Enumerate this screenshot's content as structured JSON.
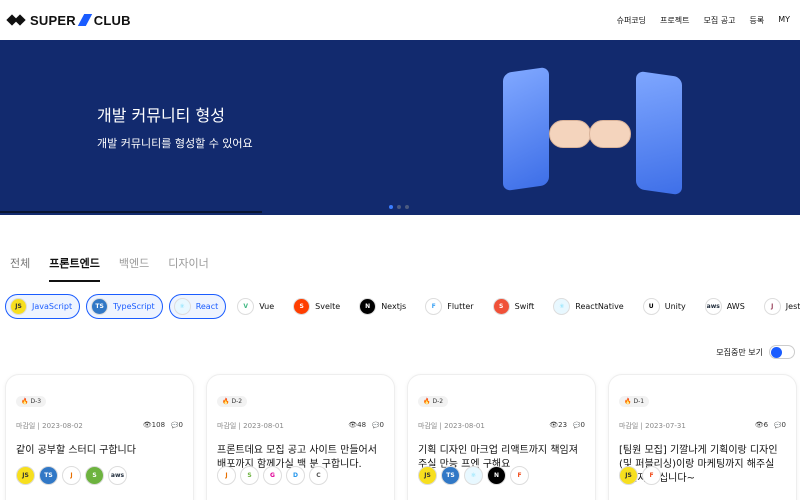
{
  "brand": {
    "name_left": "SUPER",
    "name_right": "CLUB"
  },
  "nav": [
    "슈퍼코딩",
    "프로젝트",
    "모집 공고",
    "등록",
    "MY"
  ],
  "hero": {
    "title": "개발 커뮤니티 형성",
    "subtitle": "개발 커뮤니티를 형성할 수 있어요"
  },
  "tabs": [
    "전체",
    "프론트엔드",
    "백엔드",
    "디자이너"
  ],
  "stacks": [
    {
      "label": "JavaScript",
      "abbr": "JS",
      "color": "#f7df1e",
      "fg": "#333",
      "selected": true
    },
    {
      "label": "TypeScript",
      "abbr": "TS",
      "color": "#3178c6",
      "fg": "#fff",
      "selected": true
    },
    {
      "label": "React",
      "abbr": "⚛",
      "color": "#e8f8ff",
      "fg": "#61dafb",
      "selected": true
    },
    {
      "label": "Vue",
      "abbr": "V",
      "color": "#fff",
      "fg": "#41b883",
      "selected": false
    },
    {
      "label": "Svelte",
      "abbr": "S",
      "color": "#ff3e00",
      "fg": "#fff",
      "selected": false
    },
    {
      "label": "Nextjs",
      "abbr": "N",
      "color": "#000",
      "fg": "#fff",
      "selected": false
    },
    {
      "label": "Flutter",
      "abbr": "F",
      "color": "#fff",
      "fg": "#42a5f5",
      "selected": false
    },
    {
      "label": "Swift",
      "abbr": "S",
      "color": "#f05138",
      "fg": "#fff",
      "selected": false
    },
    {
      "label": "ReactNative",
      "abbr": "⚛",
      "color": "#e8f8ff",
      "fg": "#61dafb",
      "selected": false
    },
    {
      "label": "Unity",
      "abbr": "U",
      "color": "#fff",
      "fg": "#000",
      "selected": false
    },
    {
      "label": "AWS",
      "abbr": "aws",
      "color": "#fff",
      "fg": "#232f3e",
      "selected": false
    },
    {
      "label": "Jest",
      "abbr": "J",
      "color": "#fff",
      "fg": "#99425b",
      "selected": false
    }
  ],
  "toggle_label": "모집중만 보기",
  "cards": [
    {
      "dday": "D-3",
      "deadline": "마감일 | 2023-08-02",
      "views": "108",
      "comments": "0",
      "title": "같이 공부할 스터디 구합니다",
      "icons": [
        {
          "abbr": "JS",
          "color": "#f7df1e",
          "fg": "#333",
          "name": "javascript-icon"
        },
        {
          "abbr": "TS",
          "color": "#3178c6",
          "fg": "#fff",
          "name": "typescript-icon"
        },
        {
          "abbr": "J",
          "color": "#fff",
          "fg": "#e76f00",
          "name": "java-icon"
        },
        {
          "abbr": "S",
          "color": "#6db33f",
          "fg": "#fff",
          "name": "spring-icon"
        },
        {
          "abbr": "aws",
          "color": "#fff",
          "fg": "#232f3e",
          "name": "aws-icon"
        }
      ]
    },
    {
      "dday": "D-2",
      "deadline": "마감일 | 2023-08-01",
      "views": "48",
      "comments": "0",
      "title": "프론트데요 모집 공고 사이트 만들어서 배포까지 함께가실 백 분 구합니다.",
      "icons": [
        {
          "abbr": "J",
          "color": "#fff",
          "fg": "#e76f00",
          "name": "java-icon"
        },
        {
          "abbr": "S",
          "color": "#fff",
          "fg": "#6db33f",
          "name": "spring-icon"
        },
        {
          "abbr": "G",
          "color": "#fff",
          "fg": "#e10098",
          "name": "graphql-icon"
        },
        {
          "abbr": "D",
          "color": "#fff",
          "fg": "#2496ed",
          "name": "docker-icon"
        },
        {
          "abbr": "C",
          "color": "#fff",
          "fg": "#555",
          "name": "c-icon"
        }
      ]
    },
    {
      "dday": "D-2",
      "deadline": "마감일 | 2023-08-01",
      "views": "23",
      "comments": "0",
      "title": "기획 디자인 마크업 리액트까지 책임져주실 만능 프엔 구해요",
      "icons": [
        {
          "abbr": "JS",
          "color": "#f7df1e",
          "fg": "#333",
          "name": "javascript-icon"
        },
        {
          "abbr": "TS",
          "color": "#3178c6",
          "fg": "#fff",
          "name": "typescript-icon"
        },
        {
          "abbr": "⚛",
          "color": "#e8f8ff",
          "fg": "#61dafb",
          "name": "react-icon"
        },
        {
          "abbr": "N",
          "color": "#000",
          "fg": "#fff",
          "name": "nextjs-icon"
        },
        {
          "abbr": "F",
          "color": "#fff",
          "fg": "#f24e1e",
          "name": "figma-icon"
        }
      ]
    },
    {
      "dday": "D-1",
      "deadline": "마감일 | 2023-07-31",
      "views": "6",
      "comments": "0",
      "title": "[팀원 모집] 기깔나게 기획이랑 디자인(및 퍼블리싱)이랑 마케팅까지 해주실 능력자 모십니다~",
      "icons": [
        {
          "abbr": "JS",
          "color": "#f7df1e",
          "fg": "#333",
          "name": "javascript-icon"
        },
        {
          "abbr": "F",
          "color": "#fff",
          "fg": "#f24e1e",
          "name": "figma-icon"
        }
      ]
    }
  ]
}
